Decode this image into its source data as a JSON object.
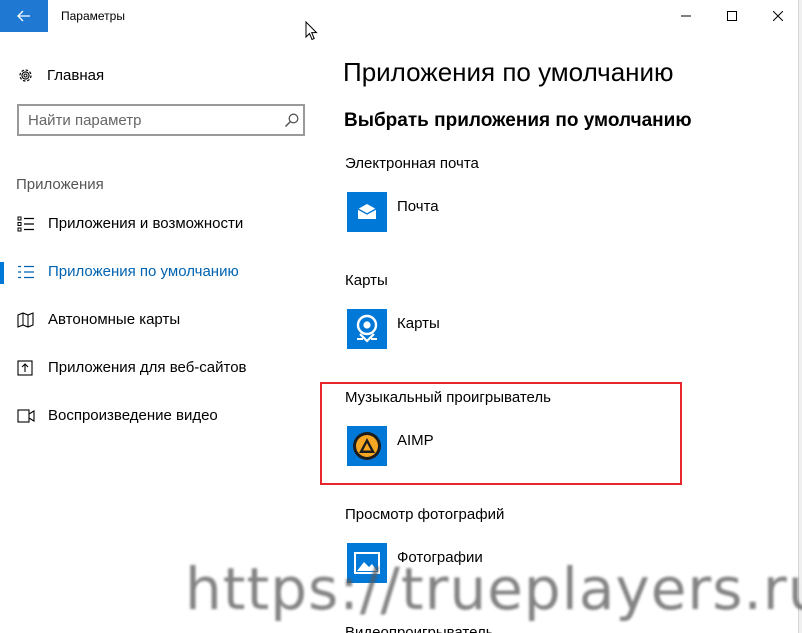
{
  "window": {
    "title": "Параметры"
  },
  "sidebar": {
    "home_label": "Главная",
    "search_placeholder": "Найти параметр",
    "section_label": "Приложения",
    "items": [
      {
        "label": "Приложения и возможности",
        "icon": "apps-features-icon",
        "active": false
      },
      {
        "label": "Приложения по умолчанию",
        "icon": "default-apps-icon",
        "active": true
      },
      {
        "label": "Автономные карты",
        "icon": "offline-maps-icon",
        "active": false
      },
      {
        "label": "Приложения для веб-сайтов",
        "icon": "apps-for-websites-icon",
        "active": false
      },
      {
        "label": "Воспроизведение видео",
        "icon": "video-playback-icon",
        "active": false
      }
    ]
  },
  "main": {
    "title": "Приложения по умолчанию",
    "subtitle": "Выбрать приложения по умолчанию",
    "categories": [
      {
        "label": "Электронная почта",
        "app": "Почта",
        "icon": "mail-icon"
      },
      {
        "label": "Карты",
        "app": "Карты",
        "icon": "maps-icon"
      },
      {
        "label": "Музыкальный проигрыватель",
        "app": "AIMP",
        "icon": "aimp-icon"
      },
      {
        "label": "Просмотр фотографий",
        "app": "Фотографии",
        "icon": "photos-icon"
      },
      {
        "label": "Видеопроигрыватель"
      }
    ]
  },
  "watermark": "https://trueplayers.ru",
  "colors": {
    "accent": "#0078d7",
    "highlight_border": "#e8262b",
    "active_text": "#0063b1"
  }
}
